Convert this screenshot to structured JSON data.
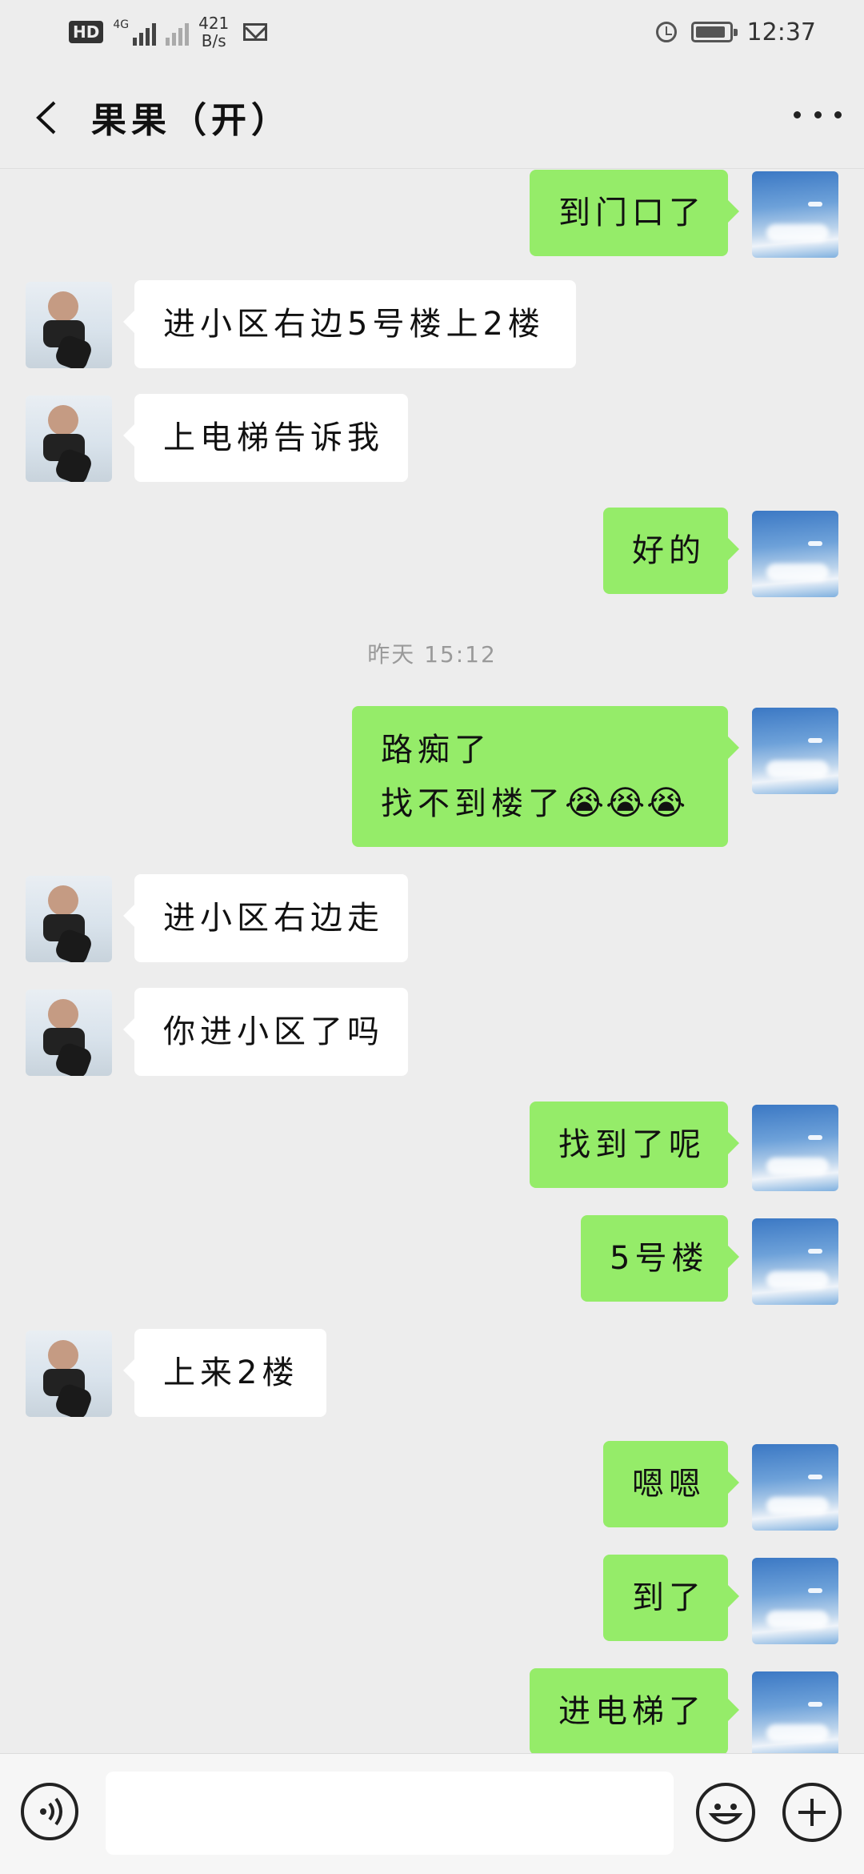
{
  "status_bar": {
    "hd": "HD",
    "network": "4G",
    "speed_value": "421",
    "speed_unit": "B/s",
    "time": "12:37",
    "icons": [
      "hd-icon",
      "signal-icon",
      "no-signal-icon",
      "mail-icon",
      "alarm-icon",
      "battery-icon"
    ]
  },
  "header": {
    "title": "果果（开）",
    "back_icon": "chevron-left-icon",
    "more_icon": "more-icon"
  },
  "messages": [
    {
      "sender": "self",
      "text": "到门口了"
    },
    {
      "sender": "other",
      "text": "进小区右边5号楼上2楼"
    },
    {
      "sender": "other",
      "text": "上电梯告诉我"
    },
    {
      "sender": "self",
      "text": "好的"
    },
    {
      "type": "timestamp",
      "text": "昨天 15:12"
    },
    {
      "sender": "self",
      "lines": [
        "路痴了",
        "找不到楼了"
      ],
      "emoji": "😭😭😭"
    },
    {
      "sender": "other",
      "text": "进小区右边走"
    },
    {
      "sender": "other",
      "text": "你进小区了吗"
    },
    {
      "sender": "self",
      "text": "找到了呢"
    },
    {
      "sender": "self",
      "text": "5号楼"
    },
    {
      "sender": "other",
      "text": "上来2楼"
    },
    {
      "sender": "self",
      "text": "嗯嗯"
    },
    {
      "sender": "self",
      "text": "到了"
    },
    {
      "sender": "self",
      "text": "进电梯了"
    }
  ],
  "input_bar": {
    "icons": [
      "voice-icon",
      "emoji-icon",
      "plus-icon"
    ],
    "text": ""
  }
}
